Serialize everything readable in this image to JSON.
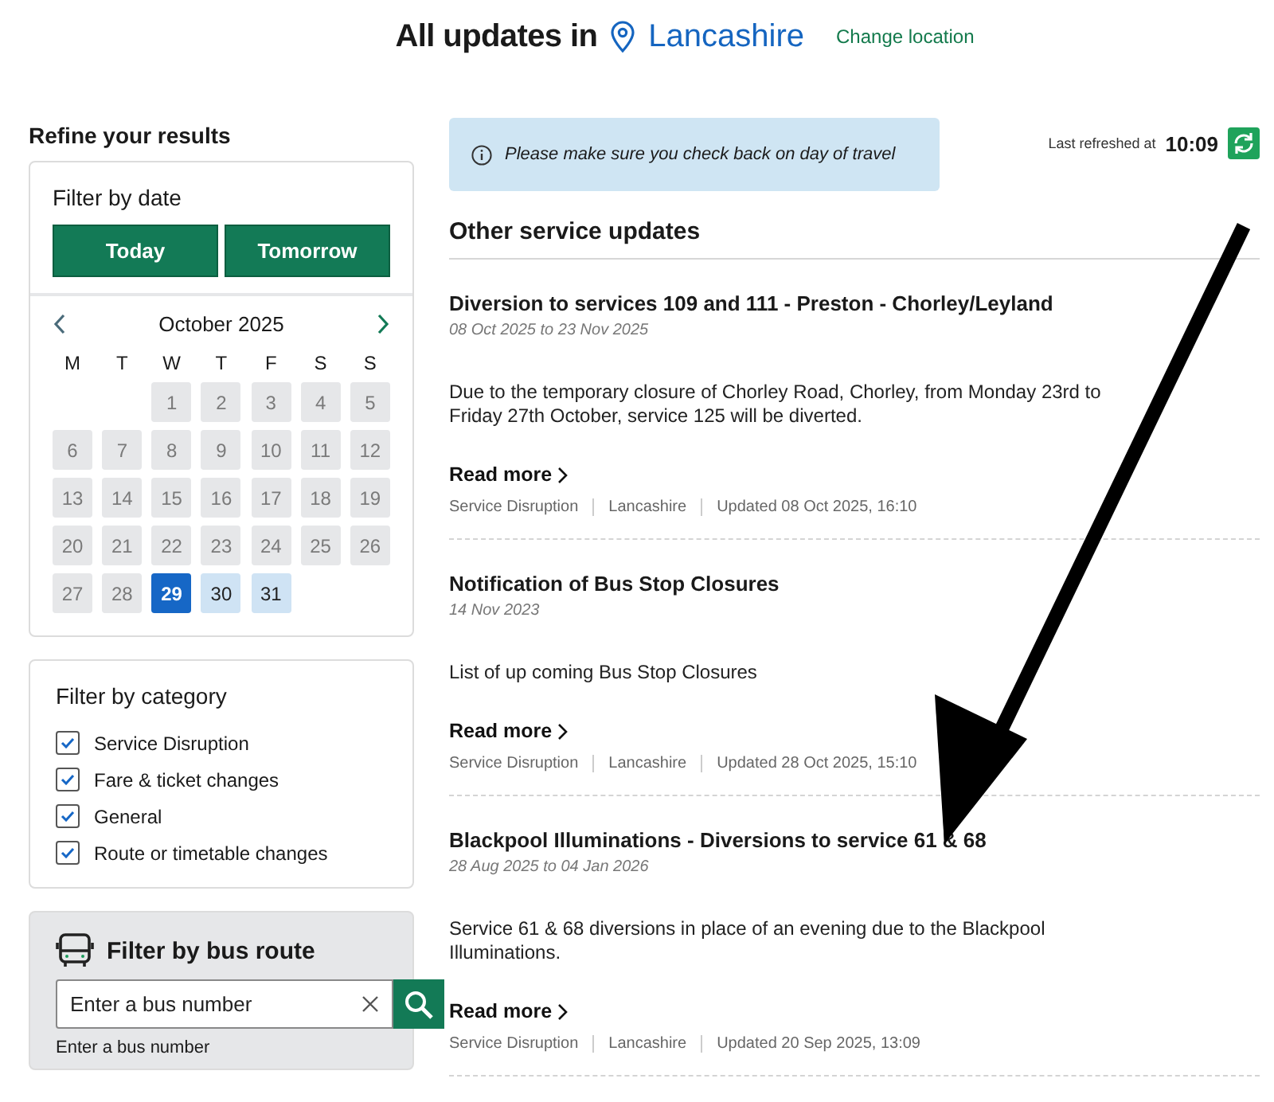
{
  "header": {
    "title": "All updates in",
    "location": "Lancashire",
    "change_link": "Change location"
  },
  "sidebar": {
    "heading": "Refine your results",
    "date_filter": {
      "heading": "Filter by date",
      "buttons": [
        "Today",
        "Tomorrow"
      ],
      "month": "October 2025",
      "weekdays": [
        "M",
        "T",
        "W",
        "T",
        "F",
        "S",
        "S"
      ],
      "days": [
        {
          "label": "1",
          "selected": false,
          "available": false
        },
        {
          "label": "2",
          "selected": false,
          "available": false
        },
        {
          "label": "3",
          "selected": false,
          "available": false
        },
        {
          "label": "4",
          "selected": false,
          "available": false
        },
        {
          "label": "5",
          "selected": false,
          "available": false
        },
        {
          "label": "6",
          "selected": false,
          "available": false
        },
        {
          "label": "7",
          "selected": false,
          "available": false
        },
        {
          "label": "8",
          "selected": false,
          "available": false
        },
        {
          "label": "9",
          "selected": false,
          "available": false
        },
        {
          "label": "10",
          "selected": false,
          "available": false
        },
        {
          "label": "11",
          "selected": false,
          "available": false
        },
        {
          "label": "12",
          "selected": false,
          "available": false
        },
        {
          "label": "13",
          "selected": false,
          "available": false
        },
        {
          "label": "14",
          "selected": false,
          "available": false
        },
        {
          "label": "15",
          "selected": false,
          "available": false
        },
        {
          "label": "16",
          "selected": false,
          "available": false
        },
        {
          "label": "17",
          "selected": false,
          "available": false
        },
        {
          "label": "18",
          "selected": false,
          "available": false
        },
        {
          "label": "19",
          "selected": false,
          "available": false
        },
        {
          "label": "20",
          "selected": false,
          "available": false
        },
        {
          "label": "21",
          "selected": false,
          "available": false
        },
        {
          "label": "22",
          "selected": false,
          "available": false
        },
        {
          "label": "23",
          "selected": false,
          "available": false
        },
        {
          "label": "24",
          "selected": false,
          "available": false
        },
        {
          "label": "25",
          "selected": false,
          "available": false
        },
        {
          "label": "26",
          "selected": false,
          "available": false
        },
        {
          "label": "27",
          "selected": false,
          "available": false
        },
        {
          "label": "28",
          "selected": false,
          "available": false
        },
        {
          "label": "29",
          "selected": true,
          "available": true
        },
        {
          "label": "30",
          "selected": false,
          "available": true
        },
        {
          "label": "31",
          "selected": false,
          "available": true
        }
      ]
    },
    "category_filter": {
      "heading": "Filter by category",
      "options": [
        {
          "label": "Service Disruption",
          "checked": true
        },
        {
          "label": "Fare & ticket changes",
          "checked": true
        },
        {
          "label": "General",
          "checked": true
        },
        {
          "label": "Route or timetable changes",
          "checked": true
        }
      ]
    },
    "route_filter": {
      "heading": "Filter by bus route",
      "placeholder": "Enter a bus number",
      "hint": "Enter a bus number"
    }
  },
  "notice": "Please make sure you check back on day of travel",
  "refresh": {
    "label": "Last refreshed at",
    "time": "10:09"
  },
  "section_title": "Other service updates",
  "updates": [
    {
      "title": "Diversion to services 109 and 111 - Preston - Chorley/Leyland",
      "dates": "08 Oct 2025 to 23 Nov 2025",
      "body": "Due to the temporary closure of Chorley Road, Chorley, from Monday 23rd to Friday 27th October, service 125 will be diverted.",
      "link": "Read more",
      "meta": [
        "Service Disruption",
        "Lancashire",
        "Updated 08 Oct 2025, 16:10"
      ]
    },
    {
      "title": "Notification of Bus Stop Closures",
      "dates": "14 Nov 2023",
      "body": "List of up coming Bus Stop Closures",
      "link": "Read more",
      "meta": [
        "Service Disruption",
        "Lancashire",
        "Updated 28 Oct 2025, 15:10"
      ]
    },
    {
      "title": "Blackpool Illuminations - Diversions to service 61 & 68",
      "dates": "28 Aug 2025 to 04 Jan 2026",
      "body": "Service 61 & 68 diversions in place of an evening due to the Blackpool Illuminations.",
      "link": "Read more",
      "meta": [
        "Service Disruption",
        "Lancashire",
        "Updated 20 Sep 2025, 13:09"
      ]
    }
  ]
}
